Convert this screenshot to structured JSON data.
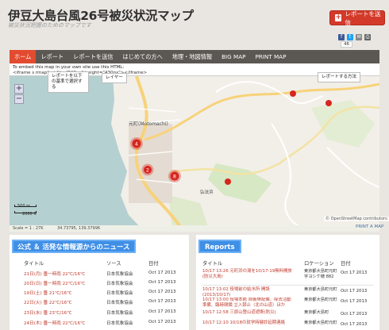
{
  "header": {
    "title": "伊豆大島台風26号被災状況マップ",
    "subtitle": "被災状況把握のためのマップです",
    "report_button": "レポートを送信",
    "share_count": "46"
  },
  "nav": {
    "items": [
      "ホーム",
      "レポート",
      "レポートを送信",
      "はじめての方へ",
      "地理・地図情報",
      "BIG MAP",
      "PRINT MAP"
    ],
    "active": "ホーム"
  },
  "map": {
    "embed_text": "To embed this map in your own site use this HTML:",
    "embed_code": "<iframe s                                          rmap\" width=\"515px\" height=\"430px\"></iframe>",
    "tooltip_report_select": "レポートを以下の基準で選択する",
    "tooltip_layer": "レイヤー",
    "tooltip_report_method": "レポートする方法",
    "scale_label_m": "500 m",
    "scale_label_ft": "2000 ft",
    "scale_ratio": "Scale = 1 : 27K",
    "coordinates": "34.73795, 139.37996",
    "attribution": "© OpenStreetMap contributors",
    "print_map": "PRINT A MAP",
    "zoom_in": "+",
    "zoom_out": "−",
    "cluster_markers": [
      {
        "label": "4"
      },
      {
        "label": "2"
      },
      {
        "label": "8"
      }
    ],
    "place_labels": [
      "元町",
      "(Motomachi)",
      "弘法浜"
    ]
  },
  "news": {
    "heading": "公式 ＆ 活発な情報源からのニュース",
    "columns": [
      "タイトル",
      "ソース",
      "日付"
    ],
    "rows": [
      {
        "title": "21日(月) 曇一時雨 22℃/16℃",
        "source": "日本気象協会",
        "date": "Oct 17 2013"
      },
      {
        "title": "20日(日) 曇一時雨 22℃/16℃",
        "source": "日本気象協会",
        "date": "Oct 17 2013"
      },
      {
        "title": "19日(土) 曇 21℃/16℃",
        "source": "日本気象協会",
        "date": "Oct 17 2013"
      },
      {
        "title": "22日(火) 曇 22℃/16℃",
        "source": "日本気象協会",
        "date": "Oct 17 2013"
      },
      {
        "title": "23日(水) 曇 23℃/16℃",
        "source": "日本気象協会",
        "date": "Oct 17 2013"
      },
      {
        "title": "24日(木) 曇一時雨 22℃/16℃",
        "source": "日本気象協会",
        "date": "Oct 17 2013"
      }
    ]
  },
  "reports": {
    "heading": "Reports",
    "columns": [
      "タイトル",
      "ロケーション",
      "日付"
    ],
    "rows": [
      {
        "title": "10/17 13:26 元町浜の湯を10/17-19無料開放(防災大島)",
        "location": "東京都大島町元町字ヨシケ穂 882",
        "date": "Oct 17 2013"
      },
      {
        "title": "10/17 13:02 役場前の給水所 開設(2013/10/17)",
        "location": "東京都大島町元町",
        "date": "Oct 17 2013"
      },
      {
        "title": "10/17 13:00 役場本館 自衛隊配備、除去活動準備、臨時閉鎖 立入禁止（北の山道）ほか",
        "location": "東京都大島町元町",
        "date": "Oct 17 2013"
      },
      {
        "title": "10/17 12:58 三原山登山道遮断(防災)",
        "location": "東京都大島町",
        "date": "Oct 17 2013"
      },
      {
        "title": "10/17 12:10 10/18の就学時健診延期連絡",
        "location": "東京都大島町元町",
        "date": "Oct 17 2013"
      }
    ]
  },
  "colors": {
    "accent_red": "#d33a2a",
    "nav_bg": "#5b5752",
    "nav_active": "#e24b2f",
    "panel_heading": "#3f8fe6",
    "marker_red": "#d7261e"
  }
}
